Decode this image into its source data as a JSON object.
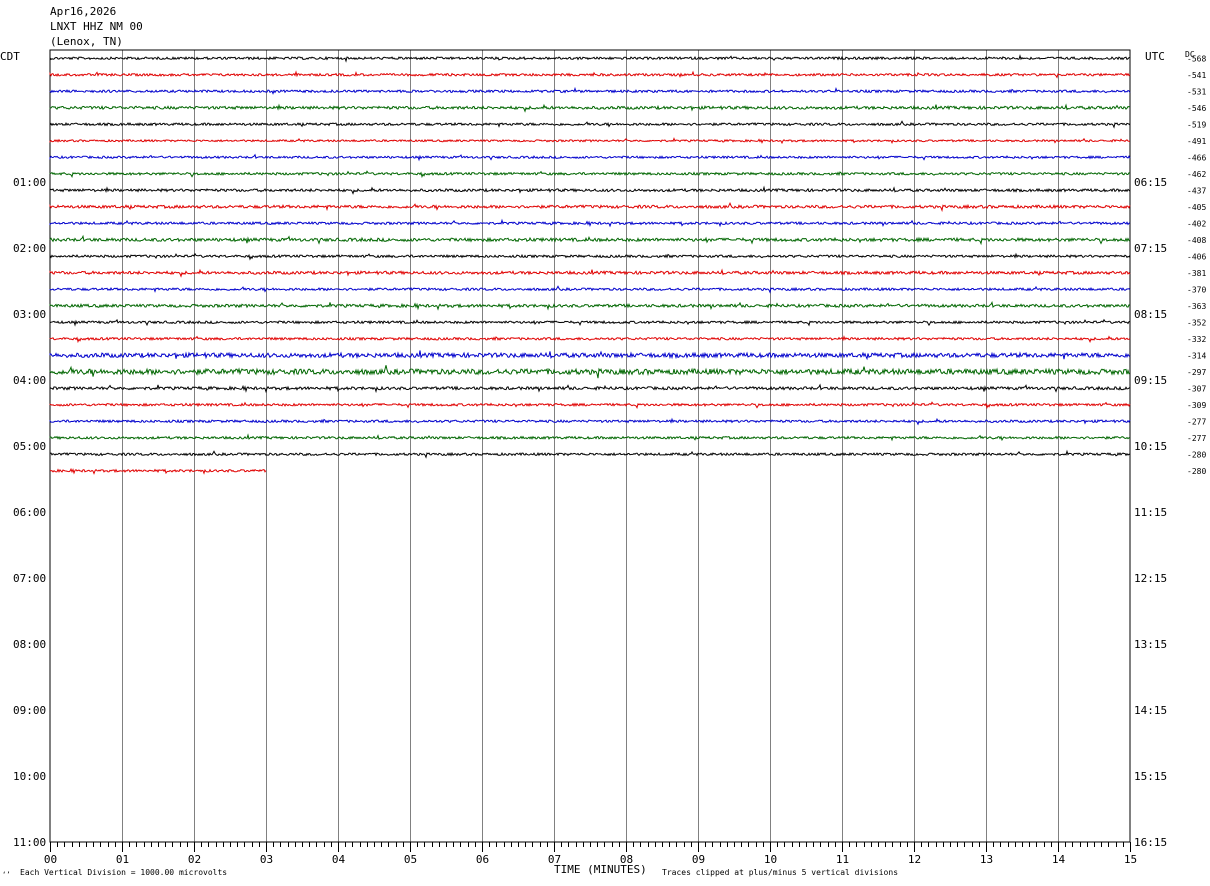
{
  "header": {
    "date": "Apr16,2026",
    "station": "LNXT HHZ NM 00",
    "location": "(Lenox, TN)"
  },
  "left_zone": "CDT",
  "right_zone": "UTC",
  "dc_label": "DC",
  "footer": {
    "corner": "‘’",
    "scale_note": "Each Vertical Division = 1000.00 microvolts",
    "x_title": "TIME (MINUTES)",
    "clip_note": "Traces clipped at plus/minus 5 vertical divisions"
  },
  "colors": {
    "black": "#000000",
    "red": "#e00000",
    "blue": "#0000cc",
    "green": "#006600",
    "grid": "#808080"
  },
  "chart_data": {
    "type": "line",
    "x_ticks": [
      "00",
      "01",
      "02",
      "03",
      "04",
      "05",
      "06",
      "07",
      "08",
      "09",
      "10",
      "11",
      "12",
      "13",
      "14",
      "15"
    ],
    "x_range_minutes": [
      0,
      15
    ],
    "left_hour_labels": [
      "01:00",
      "02:00",
      "03:00",
      "04:00",
      "05:00",
      "06:00",
      "07:00",
      "08:00",
      "09:00",
      "10:00",
      "11:00"
    ],
    "right_hour_labels": [
      "06:15",
      "07:15",
      "08:15",
      "09:15",
      "10:15",
      "11:15",
      "12:15",
      "13:15",
      "14:15",
      "15:15",
      "16:15"
    ],
    "traces_per_hour": 4,
    "trace_color_cycle": [
      "black",
      "red",
      "blue",
      "green"
    ],
    "total_rows": 48,
    "dc_offsets": [
      "-568",
      "-541",
      "-531",
      "-546",
      "-519",
      "-491",
      "-466",
      "-462",
      "-437",
      "-405",
      "-402",
      "-408",
      "-406",
      "-381",
      "-370",
      "-363",
      "-352",
      "-332",
      "-314",
      "-297",
      "-307",
      "-309",
      "-277",
      "-277",
      "-280",
      "-280"
    ],
    "trace_length_minutes": [
      15,
      15,
      15,
      15,
      15,
      15,
      15,
      15,
      15,
      15,
      15,
      15,
      15,
      15,
      15,
      15,
      15,
      15,
      15,
      15,
      15,
      15,
      15,
      15,
      15,
      3
    ],
    "trace_noise_level": [
      1.0,
      1.0,
      1.0,
      1.2,
      1.0,
      0.8,
      0.9,
      1.0,
      1.1,
      1.2,
      1.0,
      1.3,
      1.0,
      1.2,
      1.0,
      1.2,
      1.0,
      1.0,
      1.8,
      2.2,
      1.2,
      1.0,
      1.0,
      1.0,
      1.0,
      1.0
    ]
  }
}
